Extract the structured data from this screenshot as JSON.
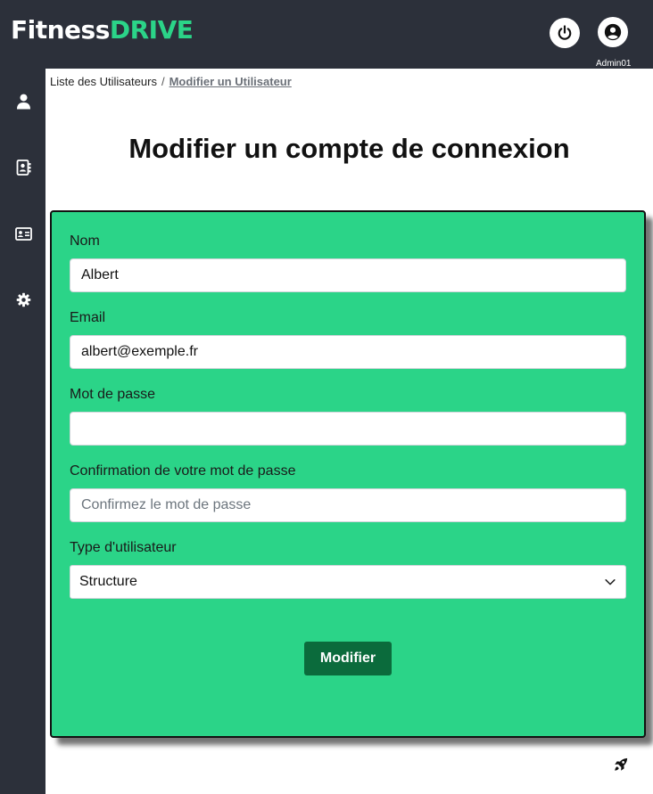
{
  "brand": {
    "part1": "Fitness",
    "part2": "DRIVE"
  },
  "header": {
    "logout_icon": "power-icon",
    "account_icon": "user-circle-icon",
    "user_name": "Admin01"
  },
  "sidebar": {
    "items": [
      {
        "icon": "user-icon"
      },
      {
        "icon": "address-book-icon"
      },
      {
        "icon": "id-card-icon"
      },
      {
        "icon": "gear-icon"
      }
    ]
  },
  "breadcrumb": {
    "parent": "Liste des Utilisateurs",
    "separator": "/",
    "current": "Modifier un Utilisateur"
  },
  "page": {
    "title": "Modifier un compte de connexion"
  },
  "form": {
    "name_label": "Nom",
    "name_value": "Albert",
    "email_label": "Email",
    "email_value": "albert@exemple.fr",
    "password_label": "Mot de passe",
    "password_value": "",
    "confirm_label": "Confirmation de votre mot de passe",
    "confirm_placeholder": "Confirmez le mot de passe",
    "type_label": "Type d'utilisateur",
    "type_value": "Structure",
    "submit_label": "Modifier"
  },
  "footer": {
    "icon": "rocket-icon"
  },
  "colors": {
    "dark": "#2c303a",
    "accent": "#2bd488",
    "button": "#0b6b3c"
  }
}
